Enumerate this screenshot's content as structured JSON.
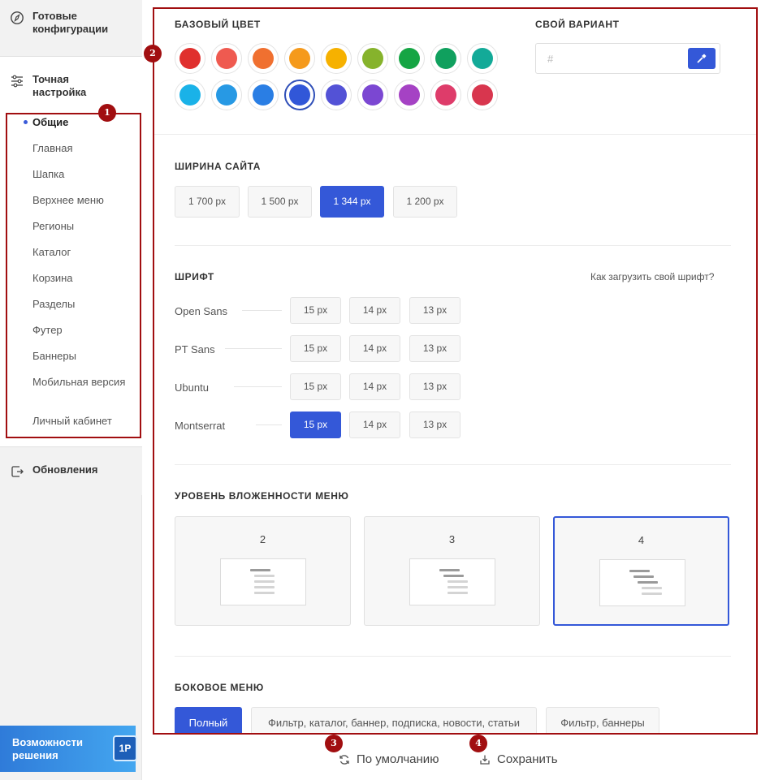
{
  "sidebar": {
    "ready_configs": {
      "icon": "compass-icon",
      "label": "Готовые конфигурации"
    },
    "fine_tuning": {
      "icon": "sliders-icon",
      "label": "Точная настройка",
      "items": [
        "Общие",
        "Главная",
        "Шапка",
        "Верхнее меню",
        "Регионы",
        "Каталог",
        "Корзина",
        "Разделы",
        "Футер",
        "Баннеры",
        "Мобильная версия",
        "Личный кабинет"
      ],
      "active_item": "Общие"
    },
    "updates": {
      "icon": "update-icon",
      "label": "Обновления"
    },
    "promo": {
      "label": "Возможности решения",
      "logo_text": "1Р"
    }
  },
  "badges": [
    "1",
    "2",
    "3",
    "4"
  ],
  "base_color": {
    "title": "БАЗОВЫЙ ЦВЕТ",
    "swatches": [
      "#e0302e",
      "#ef5a50",
      "#f07030",
      "#f59a1c",
      "#f6b100",
      "#86b32c",
      "#15a544",
      "#10a05e",
      "#13aa98",
      "#1ab2e8",
      "#2799e4",
      "#2a7ee4",
      "#3157d8",
      "#5352d6",
      "#7b47d2",
      "#a542c4",
      "#de3c6a",
      "#d8364e"
    ],
    "selected_index": 12
  },
  "custom_color": {
    "title": "СВОЙ ВАРИАНТ",
    "placeholder": "#",
    "picker_icon": "eyedropper-icon"
  },
  "site_width": {
    "title": "ШИРИНА САЙТА",
    "options": [
      "1 700 px",
      "1 500 px",
      "1 344 px",
      "1 200 px"
    ],
    "selected": "1 344 px"
  },
  "font": {
    "title": "ШРИФТ",
    "help_link": "Как загрузить свой шрифт?",
    "sizes": [
      "15 px",
      "14 px",
      "13 px"
    ],
    "rows": [
      {
        "name": "Open Sans",
        "selected_size": null
      },
      {
        "name": "PT Sans",
        "selected_size": null
      },
      {
        "name": "Ubuntu",
        "selected_size": null
      },
      {
        "name": "Montserrat",
        "selected_size": "15 px"
      }
    ]
  },
  "menu_depth": {
    "title": "УРОВЕНЬ ВЛОЖЕННОСТИ МЕНЮ",
    "options": [
      "2",
      "3",
      "4"
    ],
    "selected": "4"
  },
  "side_menu": {
    "title": "БОКОВОЕ МЕНЮ",
    "options": [
      "Полный",
      "Фильтр, каталог, баннер, подписка, новости, статьи",
      "Фильтр, баннеры"
    ],
    "selected": "Полный"
  },
  "actions": {
    "reset": {
      "label": "По умолчанию",
      "icon": "refresh-icon"
    },
    "save": {
      "label": "Сохранить",
      "icon": "save-icon"
    }
  }
}
